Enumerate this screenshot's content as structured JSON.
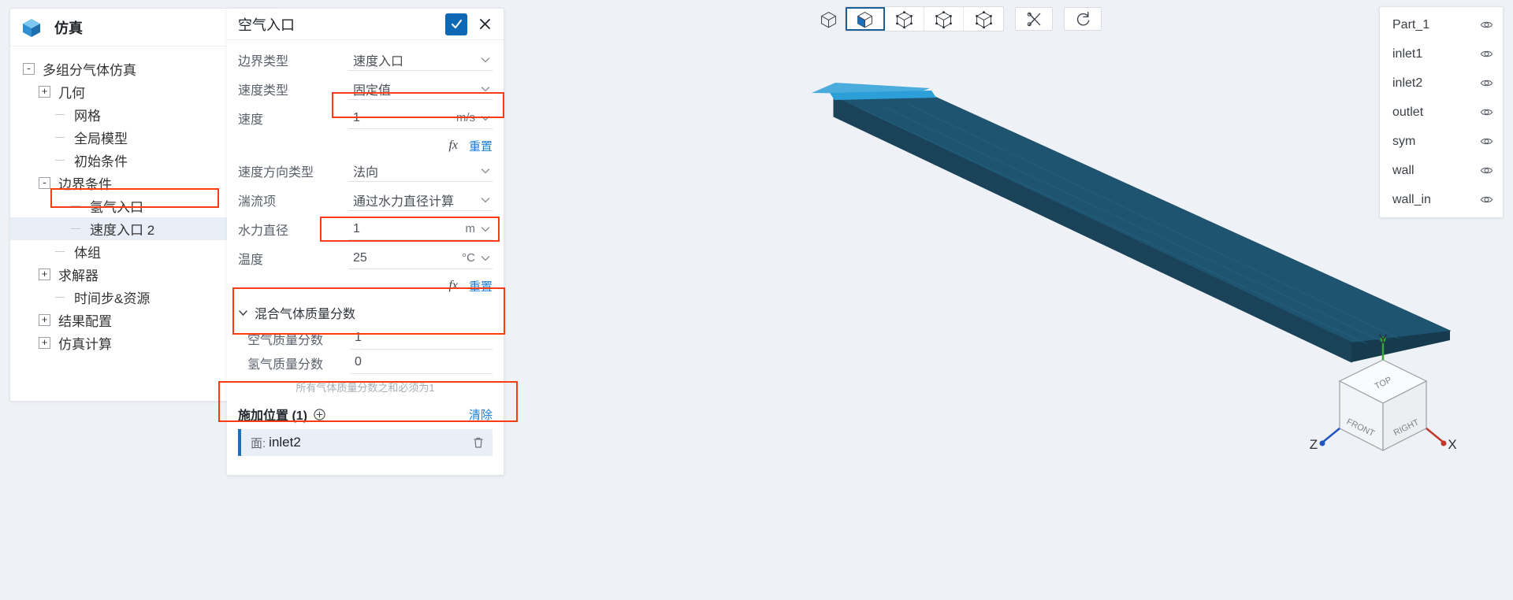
{
  "sidebar": {
    "app_title": "仿真",
    "app_icon": "cube-icon",
    "collapse_icon": "caret-down-icon",
    "tree": [
      {
        "label": "多组分气体仿真",
        "toggle": "-",
        "depth": 0,
        "trailing": "info-badge",
        "selected": false
      },
      {
        "label": "几何",
        "toggle": "+",
        "depth": 1,
        "trailing": "",
        "selected": false
      },
      {
        "label": "网格",
        "toggle": "stub",
        "depth": 2,
        "trailing": "",
        "selected": false
      },
      {
        "label": "全局模型",
        "toggle": "stub",
        "depth": 2,
        "trailing": "",
        "selected": false
      },
      {
        "label": "初始条件",
        "toggle": "stub",
        "depth": 2,
        "trailing": "",
        "selected": false
      },
      {
        "label": "边界条件",
        "toggle": "-",
        "depth": 1,
        "trailing": "plus-circle-icon",
        "selected": false
      },
      {
        "label": "氢气入口",
        "toggle": "stub",
        "depth": 3,
        "trailing": "list-icon",
        "selected": false
      },
      {
        "label": "速度入口 2",
        "toggle": "stub",
        "depth": 3,
        "trailing": "list-icon",
        "selected": true
      },
      {
        "label": "体组",
        "toggle": "stub",
        "depth": 2,
        "trailing": "plus-circle-icon",
        "selected": false
      },
      {
        "label": "求解器",
        "toggle": "+",
        "depth": 1,
        "trailing": "",
        "selected": false
      },
      {
        "label": "时间步&资源",
        "toggle": "stub",
        "depth": 2,
        "trailing": "",
        "selected": false
      },
      {
        "label": "结果配置",
        "toggle": "+",
        "depth": 1,
        "trailing": "",
        "selected": false
      },
      {
        "label": "仿真计算",
        "toggle": "+",
        "depth": 1,
        "trailing": "",
        "selected": false
      }
    ]
  },
  "panel": {
    "title": "空气入口",
    "confirm_icon": "check-icon",
    "cancel_icon": "close-icon",
    "fields": [
      {
        "label": "边界类型",
        "value": "速度入口",
        "unit": "",
        "dropdown": true
      },
      {
        "label": "速度类型",
        "value": "固定值",
        "unit": "",
        "dropdown": true
      },
      {
        "label": "速度",
        "value": "1",
        "unit": "m/s",
        "dropdown": true
      },
      {
        "label": "速度方向类型",
        "value": "法向",
        "unit": "",
        "dropdown": true
      },
      {
        "label": "湍流项",
        "value": "通过水力直径计算",
        "unit": "",
        "dropdown": true
      },
      {
        "label": "水力直径",
        "value": "1",
        "unit": "m",
        "dropdown": true
      },
      {
        "label": "温度",
        "value": "25",
        "unit": "°C",
        "dropdown": true
      }
    ],
    "fx_label": "fx",
    "reset_label": "重置",
    "section": {
      "title": "混合气体质量分数",
      "chevron": "chevron-down-icon",
      "rows": [
        {
          "label": "空气质量分数",
          "value": "1"
        },
        {
          "label": "氢气质量分数",
          "value": "0"
        }
      ],
      "note": "所有气体质量分数之和必须为1"
    },
    "location": {
      "title": "施加位置 (1)",
      "add_icon": "plus-circle-icon",
      "clear_label": "清除",
      "items": [
        {
          "prefix": "面:",
          "name": "inlet2",
          "delete_icon": "trash-icon"
        }
      ]
    }
  },
  "toolbar": {
    "buttons": [
      {
        "name": "view-box-icon",
        "active": false,
        "grouped": false
      },
      {
        "name": "select-solid-icon",
        "active": true,
        "grouped": true
      },
      {
        "name": "select-face-icon",
        "active": false,
        "grouped": true
      },
      {
        "name": "select-edge-icon",
        "active": false,
        "grouped": true
      },
      {
        "name": "select-vertex-icon",
        "active": false,
        "grouped": true
      },
      {
        "name": "section-cut-icon",
        "active": false,
        "grouped": false
      },
      {
        "name": "reset-view-icon",
        "active": false,
        "grouped": false
      }
    ]
  },
  "parts_panel": {
    "items": [
      {
        "name": "Part_1",
        "visibility_icon": "eye-icon"
      },
      {
        "name": "inlet1",
        "visibility_icon": "eye-icon"
      },
      {
        "name": "inlet2",
        "visibility_icon": "eye-icon"
      },
      {
        "name": "outlet",
        "visibility_icon": "eye-icon"
      },
      {
        "name": "sym",
        "visibility_icon": "eye-icon"
      },
      {
        "name": "wall",
        "visibility_icon": "eye-icon"
      },
      {
        "name": "wall_in",
        "visibility_icon": "eye-icon"
      }
    ]
  },
  "viewport": {
    "geometry_color": "#1d4e66",
    "edge_color": "#2d9fd8",
    "background": "#eef1f5"
  },
  "axis_triad": {
    "x_label": "X",
    "y_label": "Y",
    "z_label": "Z",
    "faces": [
      {
        "label": "TOP"
      },
      {
        "label": "FRONT"
      },
      {
        "label": "RIGHT"
      }
    ]
  },
  "annotations": {
    "highlight_color": "#fa3c14",
    "boxes": [
      "velocity-field-box",
      "temperature-field-box",
      "mass-fraction-box",
      "location-item-box",
      "tree-selected-box"
    ]
  }
}
